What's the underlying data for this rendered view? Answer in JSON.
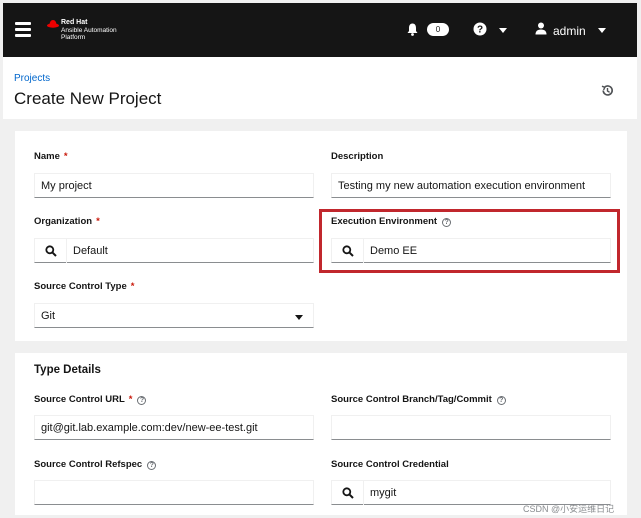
{
  "nav": {
    "logo_brand": "Red Hat",
    "logo_line1": "Ansible Automation",
    "logo_line2": "Platform",
    "notification_count": "0",
    "username": "admin"
  },
  "header": {
    "breadcrumb": "Projects",
    "title": "Create New Project"
  },
  "form": {
    "name": {
      "label": "Name",
      "required": "*",
      "value": "My project"
    },
    "description": {
      "label": "Description",
      "value": "Testing my new automation execution environment"
    },
    "organization": {
      "label": "Organization",
      "required": "*",
      "value": "Default"
    },
    "execution_environment": {
      "label": "Execution Environment",
      "value": "Demo EE"
    },
    "source_control_type": {
      "label": "Source Control Type",
      "required": "*",
      "value": "Git"
    }
  },
  "type_details": {
    "title": "Type Details",
    "scm_url": {
      "label": "Source Control URL",
      "required": "*",
      "value": "git@git.lab.example.com:dev/new-ee-test.git"
    },
    "scm_branch": {
      "label": "Source Control Branch/Tag/Commit",
      "value": ""
    },
    "scm_refspec": {
      "label": "Source Control Refspec",
      "value": ""
    },
    "scm_credential": {
      "label": "Source Control Credential",
      "value": "mygit"
    }
  },
  "watermark": "CSDN @小安运维日记",
  "colors": {
    "accent": "#06c",
    "required": "#c9190b",
    "highlight": "#c1272d",
    "nav_bg": "#151515"
  }
}
